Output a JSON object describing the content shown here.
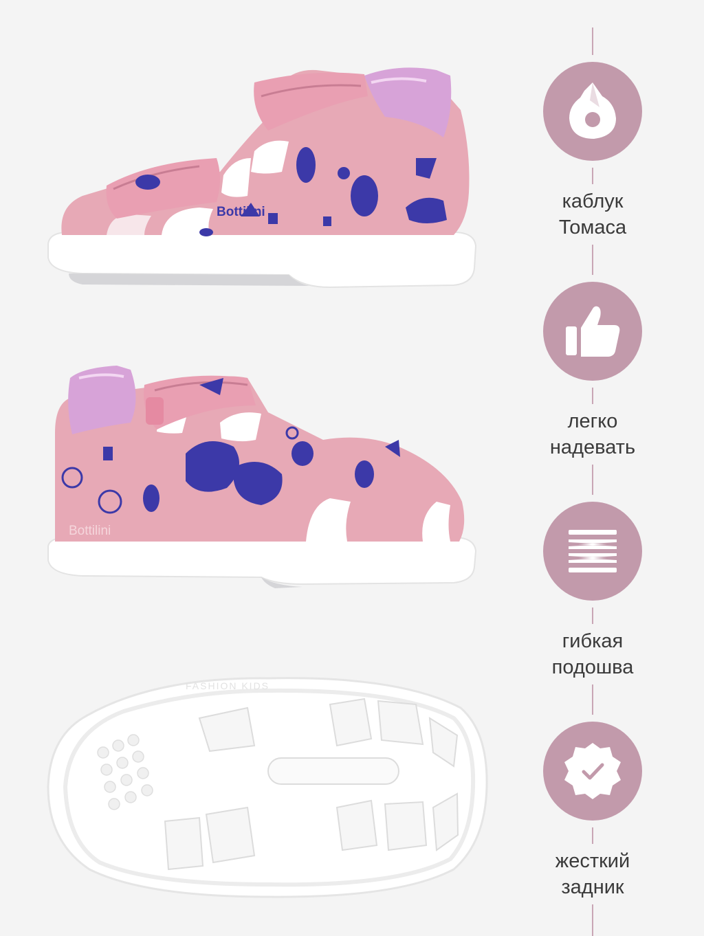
{
  "brand_print": "Bottilini",
  "sole_print": "FASHION KIDS",
  "colors": {
    "accent": "#c29aab",
    "shoe_pink": "#e7a9b6",
    "print_blue": "#3c39a8",
    "metallic_lilac": "#d7a3d8",
    "sole_white": "#ffffff",
    "text": "#3a3a3a"
  },
  "features": [
    {
      "icon": "heel-icon",
      "line1": "каблук",
      "line2": "Томаса"
    },
    {
      "icon": "thumbs-up-icon",
      "line1": "легко",
      "line2": "надевать"
    },
    {
      "icon": "flexible-sole-icon",
      "line1": "гибкая",
      "line2": "подошва"
    },
    {
      "icon": "check-badge-icon",
      "line1": "жесткий",
      "line2": "задник"
    }
  ]
}
